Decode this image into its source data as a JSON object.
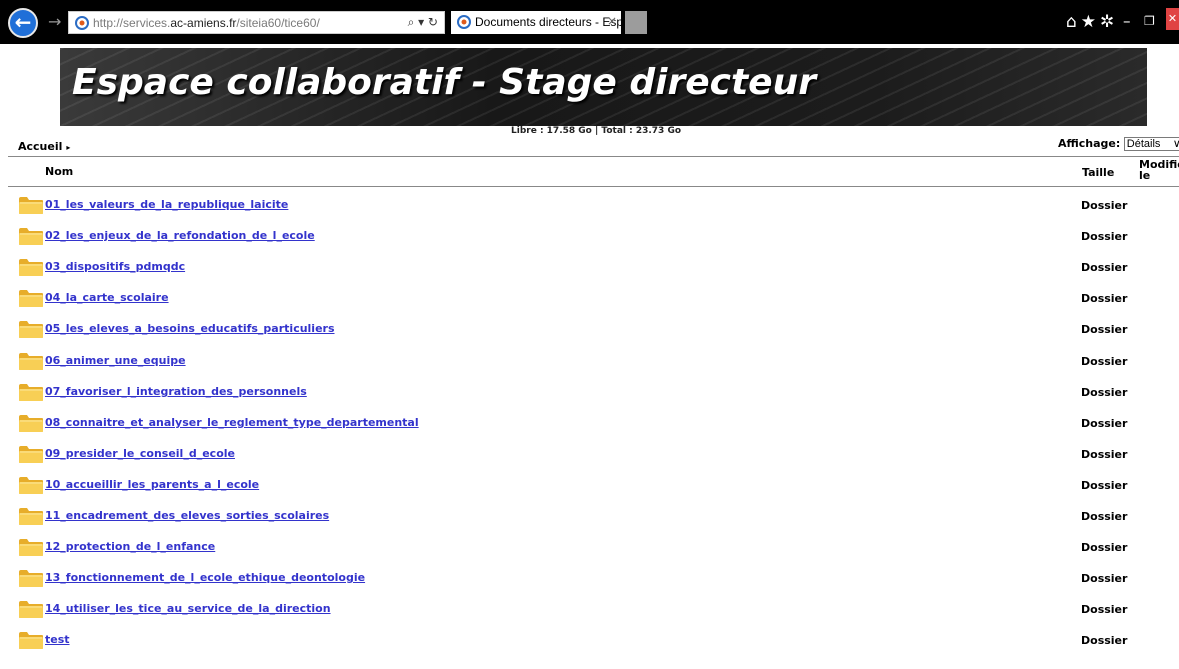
{
  "browser": {
    "url_prefix": "http://services.",
    "url_domain": "ac-amiens.fr",
    "url_path": "/siteia60/tice60/",
    "address_tools": "⌕ ▾ ↻",
    "tab_title": "Documents directeurs - Esp...",
    "tab_close": "×",
    "back_glyph": "←",
    "forward_glyph": "→",
    "icons": [
      "home-icon",
      "star-icon",
      "gear-icon"
    ],
    "minimize": "–",
    "maximize": "❐",
    "close": "✕"
  },
  "header": {
    "title": "Espace collaboratif - Stage directeur",
    "quota": "Libre : 17.58 Go | Total : 23.73 Go"
  },
  "toolbar": {
    "breadcrumb": "Accueil",
    "breadcrumb_sep": "▸",
    "view_label": "Affichage:",
    "view_value": "Détails"
  },
  "table": {
    "col_name": "Nom",
    "col_size": "Taille",
    "col_modified": "Modifié le",
    "rows": [
      {
        "name": "01_les_valeurs_de_la_republique_laicite",
        "size": "Dossier"
      },
      {
        "name": "02_les_enjeux_de_la_refondation_de_l_ecole",
        "size": "Dossier"
      },
      {
        "name": "03_dispositifs_pdmqdc",
        "size": "Dossier"
      },
      {
        "name": "04_la_carte_scolaire",
        "size": "Dossier"
      },
      {
        "name": "05_les_eleves_a_besoins_educatifs_particuliers",
        "size": "Dossier"
      },
      {
        "name": "06_animer_une_equipe",
        "size": "Dossier"
      },
      {
        "name": "07_favoriser_l_integration_des_personnels",
        "size": "Dossier"
      },
      {
        "name": "08_connaitre_et_analyser_le_reglement_type_departemental",
        "size": "Dossier"
      },
      {
        "name": "09_presider_le_conseil_d_ecole",
        "size": "Dossier"
      },
      {
        "name": "10_accueillir_les_parents_a_l_ecole",
        "size": "Dossier"
      },
      {
        "name": "11_encadrement_des_eleves_sorties_scolaires",
        "size": "Dossier"
      },
      {
        "name": "12_protection_de_l_enfance",
        "size": "Dossier"
      },
      {
        "name": "13_fonctionnement_de_l_ecole_ethique_deontologie",
        "size": "Dossier"
      },
      {
        "name": "14_utiliser_les_tice_au_service_de_la_direction",
        "size": "Dossier"
      },
      {
        "name": "test",
        "size": "Dossier"
      }
    ]
  },
  "colors": {
    "link": "#3333cc",
    "folder": "#f5c43c",
    "chrome": "#000000",
    "back_button": "#1f6fd8"
  }
}
